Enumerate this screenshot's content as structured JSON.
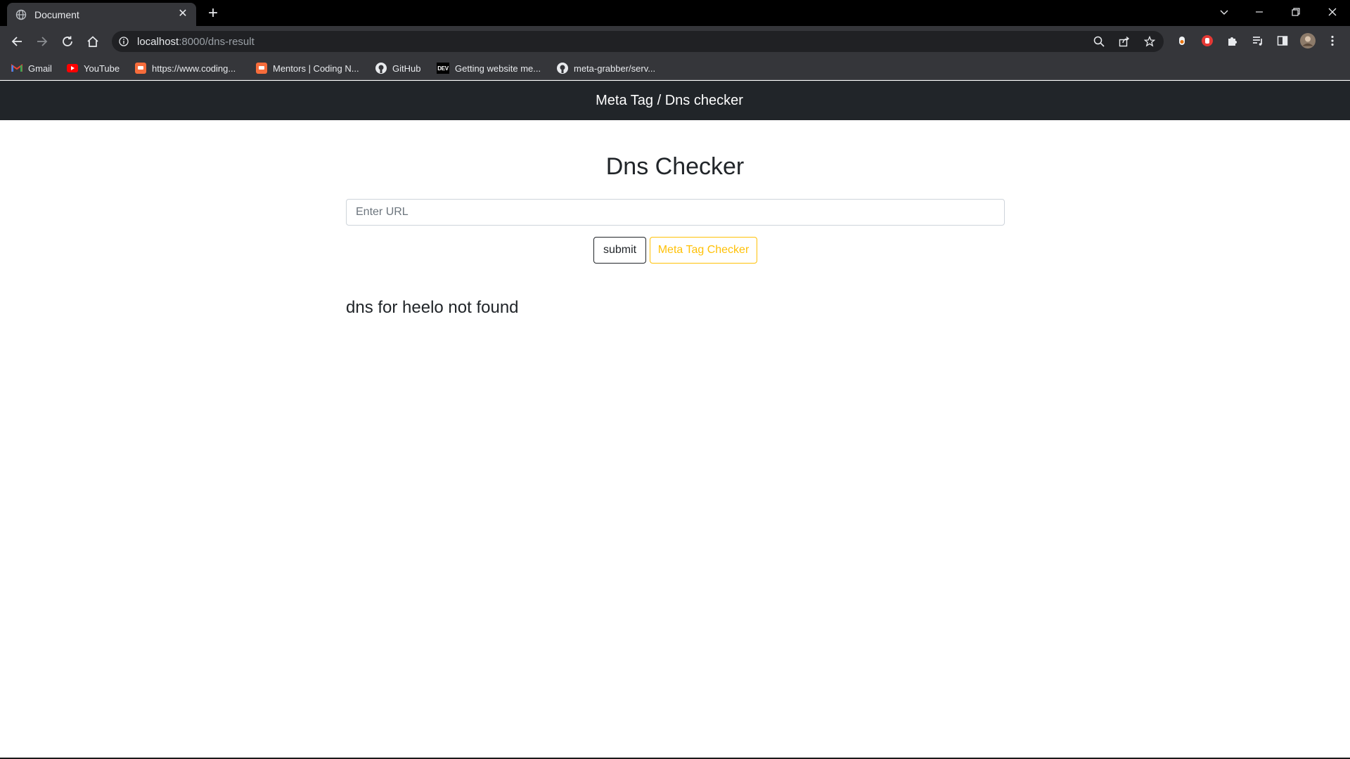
{
  "browser": {
    "tab": {
      "title": "Document"
    },
    "address_bar": {
      "host": "localhost",
      "path": ":8000/dns-result"
    },
    "bookmarks": [
      {
        "label": "Gmail",
        "icon": "gmail-icon"
      },
      {
        "label": "YouTube",
        "icon": "youtube-icon"
      },
      {
        "label": "https://www.coding...",
        "icon": "coding-ninjas-icon"
      },
      {
        "label": "Mentors | Coding N...",
        "icon": "coding-ninjas-icon"
      },
      {
        "label": "GitHub",
        "icon": "github-icon"
      },
      {
        "label": "Getting website me...",
        "icon": "dev-icon",
        "icon_text": "DEV"
      },
      {
        "label": "meta-grabber/serv...",
        "icon": "github-icon"
      }
    ]
  },
  "page": {
    "navbar_brand": "Meta Tag / Dns checker",
    "title": "Dns Checker",
    "url_input": {
      "placeholder": "Enter URL",
      "value": ""
    },
    "submit_label": "submit",
    "meta_tag_label": "Meta Tag Checker",
    "result_text": "dns for heelo not found"
  },
  "colors": {
    "navbar_bg": "#212529",
    "warning": "#ffc107",
    "text": "#212529"
  }
}
